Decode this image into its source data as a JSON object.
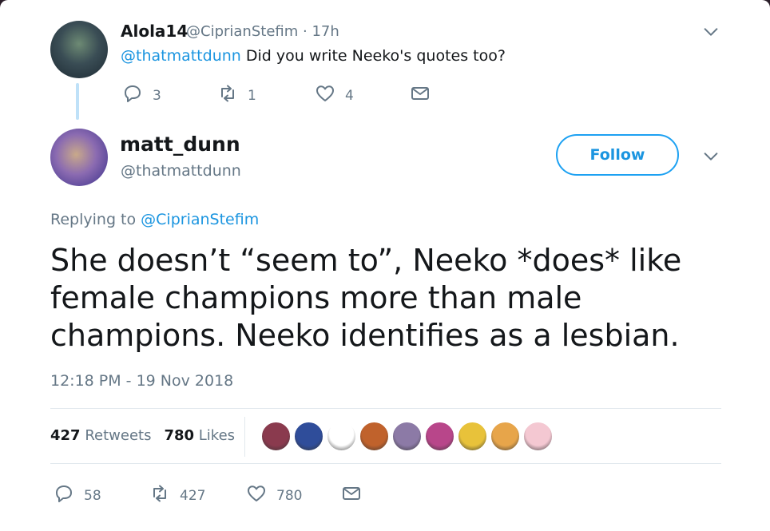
{
  "parent_tweet": {
    "name": "Alola14",
    "handle": "@CiprianStefim",
    "time": "· 17h",
    "mention": "@thatmattdunn",
    "text": " Did you write Neeko's quotes too?",
    "actions": {
      "reply_count": "3",
      "retweet_count": "1",
      "like_count": "4"
    }
  },
  "main_tweet": {
    "name": "matt_dunn",
    "handle": "@thatmattdunn",
    "follow_label": "Follow",
    "replying_prefix": "Replying to ",
    "replying_to": "@CiprianStefim",
    "text": "She doesn’t “seem to”, Neeko *does* like female champions more than male champions. Neeko identifies as a lesbian.",
    "timestamp": "12:18 PM - 19 Nov 2018",
    "stats": {
      "retweets_count": "427",
      "retweets_label": "Retweets",
      "likes_count": "780",
      "likes_label": "Likes"
    },
    "liker_colors": [
      "#8a3a4e",
      "#2f4d9a",
      "#ffffff",
      "#c0622c",
      "#8c7aa6",
      "#b8468a",
      "#e8c23a",
      "#e7a54a",
      "#f4c8d2"
    ],
    "actions": {
      "reply_count": "58",
      "retweet_count": "427",
      "like_count": "780"
    }
  },
  "colors": {
    "accent": "#1da1f2",
    "link": "#1b95e0",
    "muted": "#657786",
    "text": "#14171a"
  }
}
